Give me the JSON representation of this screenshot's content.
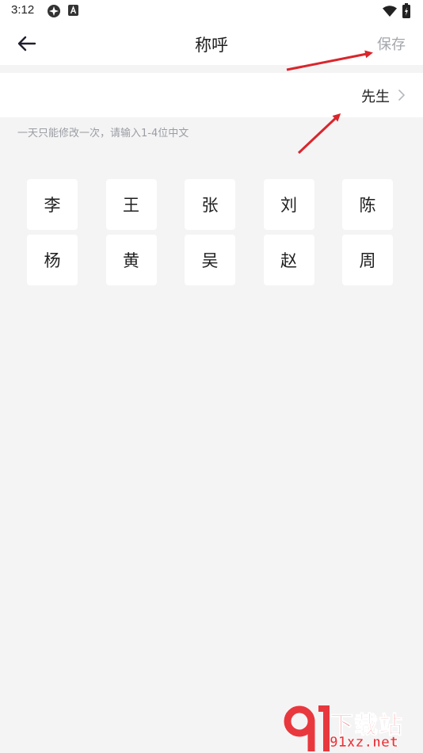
{
  "status_bar": {
    "time": "3:12"
  },
  "header": {
    "title": "称呼",
    "save_label": "保存"
  },
  "title_row": {
    "value": "先生"
  },
  "hint": "一天只能修改一次，请输入1-4位中文",
  "surnames": [
    "李",
    "王",
    "张",
    "刘",
    "陈",
    "杨",
    "黄",
    "吴",
    "赵",
    "周"
  ],
  "watermark": {
    "logo": "91",
    "top": "下载站",
    "bottom": "91xz.net"
  },
  "colors": {
    "background": "#f4f4f5",
    "card": "#ffffff",
    "save_disabled": "#a3a6ab",
    "hint": "#9a9da2",
    "annotation_arrow": "#d9262c",
    "watermark": "#e8383d"
  }
}
